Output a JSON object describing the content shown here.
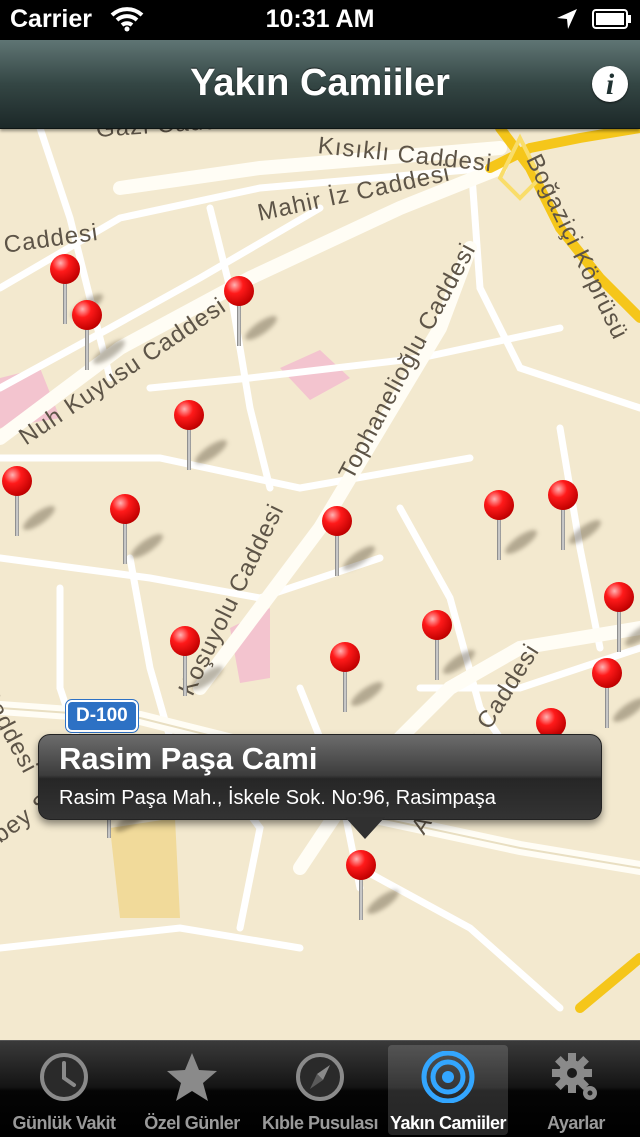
{
  "status_bar": {
    "carrier": "Carrier",
    "time": "10:31 AM"
  },
  "nav_bar": {
    "title": "Yakın Camiiler",
    "info_label": "i"
  },
  "map": {
    "streets": [
      "Gazi Caddesi",
      "Kısıklı Caddesi",
      "Mahir İz Caddesi",
      "Boğaziçi Köprüsü",
      "Caddesi",
      "Nuh Kuyusu Caddesi",
      "Tophanelioğlu Caddesi",
      "Koşuyolu Caddesi",
      "Acıbadem Caddesi",
      "Caddesi",
      "bey Sok"
    ],
    "road_badge": "D-100"
  },
  "callout": {
    "title": "Rasim Paşa Cami",
    "subtitle": "Rasim Paşa Mah., İskele Sok. No:96, Rasimpaşa"
  },
  "tab_bar": {
    "items": [
      {
        "label": "Günlük Vakit",
        "icon": "clock-icon"
      },
      {
        "label": "Özel Günler",
        "icon": "star-icon"
      },
      {
        "label": "Kıble Pusulası",
        "icon": "compass-icon"
      },
      {
        "label": "Yakın Camiiler",
        "icon": "target-icon",
        "selected": true
      },
      {
        "label": "Ayarlar",
        "icon": "gear-icon"
      }
    ]
  },
  "colors": {
    "pin": "#e00000",
    "selected_tab_icon": "#33a6ff",
    "motorway": "#f5c61a"
  }
}
